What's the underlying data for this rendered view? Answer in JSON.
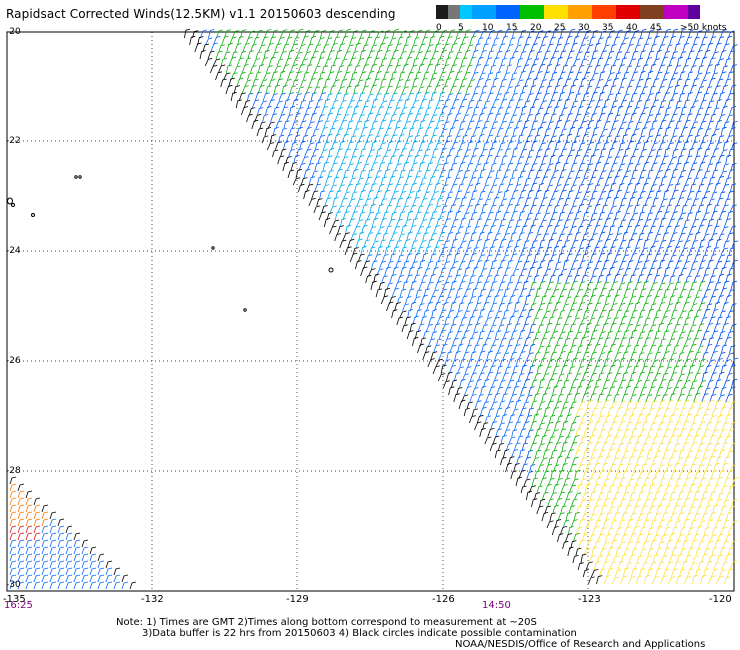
{
  "title": "Rapidsact Corrected Winds(12.5KM) v1.1 20150603 descending",
  "legend": {
    "labels": [
      "0",
      "5",
      "10",
      "15",
      "20",
      "25",
      "30",
      "35",
      "40",
      "45",
      ">50 knots"
    ],
    "colors": [
      "#1c1c1c",
      "#777777",
      "#00b4f0",
      "#0064ff",
      "#00c000",
      "#ffe000",
      "#ffa000",
      "#ff4000",
      "#e00000",
      "#804020",
      "#c000c0",
      "#6000a0"
    ]
  },
  "map": {
    "lat_labels": [
      "-20",
      "-22",
      "-24",
      "-26",
      "-28",
      "-30"
    ],
    "lon_labels": [
      "-135",
      "-132",
      "-129",
      "-126",
      "-123",
      "-120"
    ],
    "time_labels": [
      "16:25",
      "14:50"
    ]
  },
  "notes": {
    "line1": "Note: 1) Times are GMT 2)Times along bottom correspond to measurement at ~20S",
    "line2": "3)Data buffer is 22 hrs from 20150603 4) Black circles indicate possible contamination",
    "line3": "NOAA/NESDIS/Office of Research and Applications"
  }
}
